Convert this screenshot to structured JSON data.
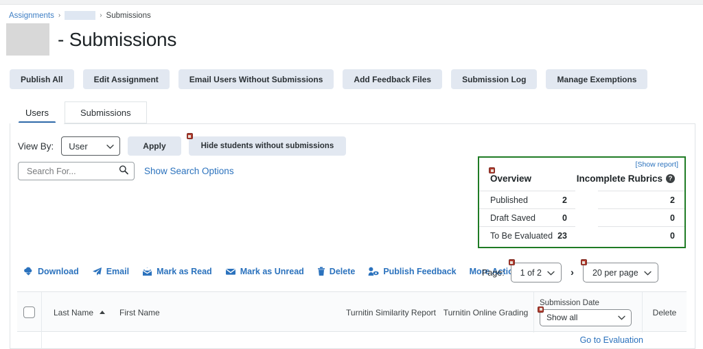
{
  "breadcrumb": {
    "assignments": "Assignments",
    "sep": "›",
    "submissions": "Submissions"
  },
  "page_title": "- Submissions",
  "action_buttons": [
    {
      "label": "Publish All"
    },
    {
      "label": "Edit Assignment"
    },
    {
      "label": "Email Users Without Submissions"
    },
    {
      "label": "Add Feedback Files"
    },
    {
      "label": "Submission Log"
    },
    {
      "label": "Manage Exemptions"
    }
  ],
  "tabs": [
    {
      "label": "Users",
      "active": true
    },
    {
      "label": "Submissions",
      "active": false
    }
  ],
  "filters": {
    "view_by_label": "View By:",
    "view_by_value": "User",
    "apply_label": "Apply",
    "hide_students_label": "Hide students without submissions"
  },
  "search": {
    "placeholder": "Search For...",
    "value": "",
    "show_options_label": "Show Search Options"
  },
  "overview": {
    "show_report_label": "[Show report]",
    "title_left": "Overview",
    "title_right": "Incomplete Rubrics",
    "rows": [
      {
        "label": "Published",
        "count": "2",
        "rubrics": "2"
      },
      {
        "label": "Draft Saved",
        "count": "0",
        "rubrics": "0"
      },
      {
        "label": "To Be Evaluated",
        "count": "23",
        "rubrics": "0"
      }
    ]
  },
  "toolbar": [
    {
      "label": "Download",
      "icon": "download-cloud-icon"
    },
    {
      "label": "Email",
      "icon": "paper-plane-icon"
    },
    {
      "label": "Mark as Read",
      "icon": "envelope-open-icon"
    },
    {
      "label": "Mark as Unread",
      "icon": "envelope-closed-icon"
    },
    {
      "label": "Delete",
      "icon": "trash-icon"
    },
    {
      "label": "Publish Feedback",
      "icon": "person-eye-icon"
    },
    {
      "label": "More Actions",
      "icon": "chevron-down-icon"
    }
  ],
  "pagination": {
    "page_label": "Page:",
    "page_value": "1 of 2",
    "per_page_value": "20 per page"
  },
  "table": {
    "columns": {
      "last_name": "Last Name",
      "first_name": "First Name",
      "similarity": "Turnitin Similarity Report",
      "online_grading": "Turnitin Online Grading",
      "submission_date": "Submission Date",
      "delete": "Delete"
    },
    "date_filter_value": "Show all",
    "go_to_evaluation": "Go to Evaluation"
  },
  "colors": {
    "accent_link": "#2b72bd",
    "overview_border": "#1e7b24",
    "button_bg": "#e2e8f1",
    "tab_underline": "#2d68a8",
    "marker_red": "#b03a2e"
  }
}
